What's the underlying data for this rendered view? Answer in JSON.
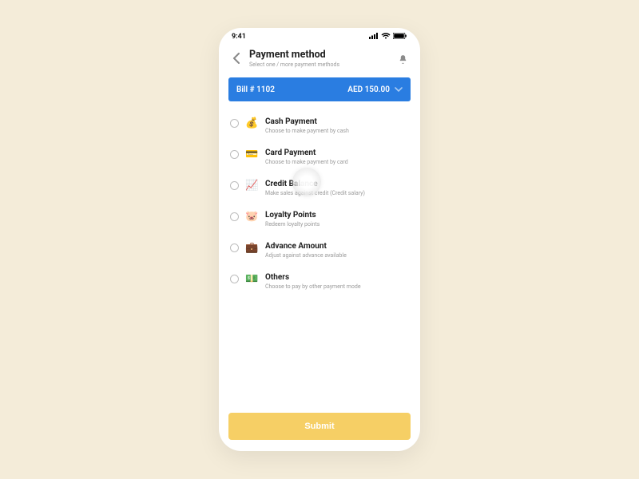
{
  "status": {
    "time": "9:41"
  },
  "header": {
    "title": "Payment method",
    "subtitle": "Select one / more payment methods"
  },
  "bill": {
    "label": "Bill # 1102",
    "amount": "AED 150.00"
  },
  "methods": [
    {
      "icon": "💰",
      "title": "Cash Payment",
      "subtitle": "Choose to make payment by cash"
    },
    {
      "icon": "💳",
      "title": "Card Payment",
      "subtitle": "Choose to make payment by card"
    },
    {
      "icon": "📈",
      "title": "Credit Balance",
      "subtitle": "Make sales against credit (Credit salary)"
    },
    {
      "icon": "🐷",
      "title": "Loyalty Points",
      "subtitle": "Redeem loyalty points"
    },
    {
      "icon": "💼",
      "title": "Advance Amount",
      "subtitle": "Adjust against advance available"
    },
    {
      "icon": "💵",
      "title": "Others",
      "subtitle": "Choose to pay by other payment mode"
    }
  ],
  "submit": {
    "label": "Submit"
  }
}
